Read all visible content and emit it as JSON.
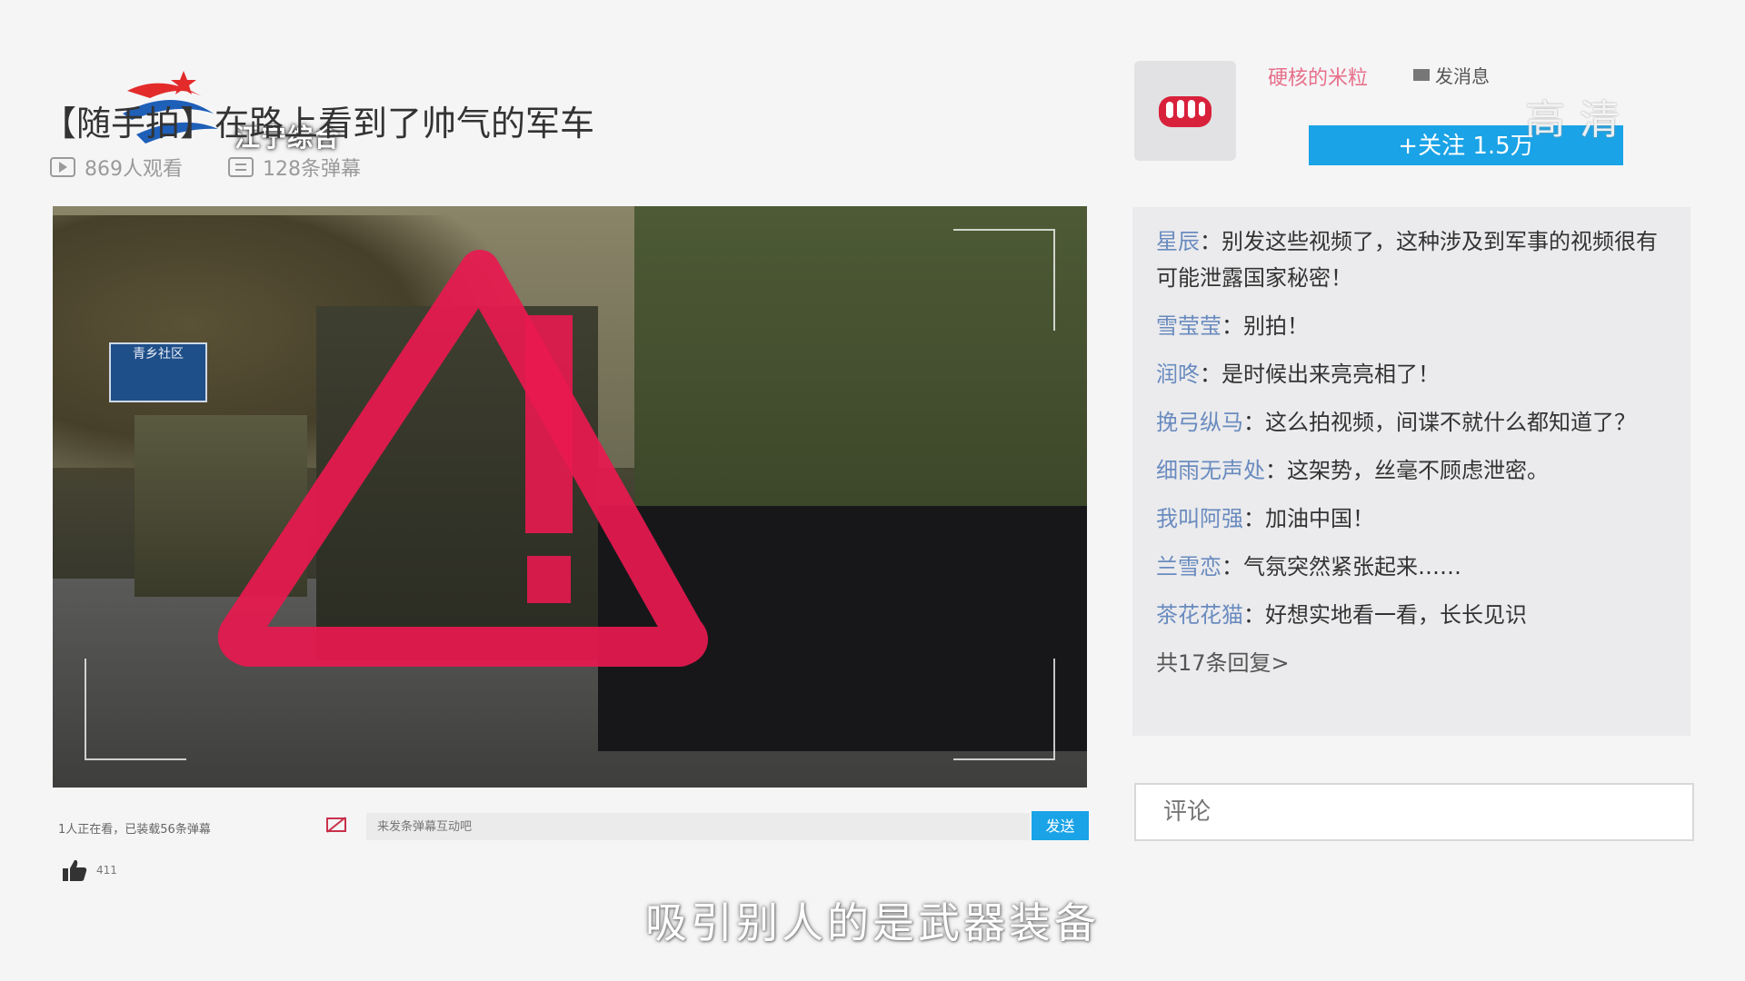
{
  "broadcast": {
    "station_logo_text": "江宁综合",
    "quality_badge": "高清",
    "subtitle": "吸引别人的是武器装备"
  },
  "video": {
    "title": "【随手拍】在路上看到了帅气的军车",
    "views": "869人观看",
    "danmaku_count": "128条弹幕",
    "road_sign": "青乡社区"
  },
  "danmaku_bar": {
    "status": "1人正在看，已装载56条弹幕",
    "input_placeholder": "来发条弹幕互动吧",
    "send_label": "发送",
    "like_count": "411"
  },
  "uploader": {
    "name": "硬核的米粒",
    "message_label": "发消息",
    "follow_label": "+关注  1.5万"
  },
  "comments": [
    {
      "user": "星辰",
      "text": "别发这些视频了，这种涉及到军事的视频很有可能泄露国家秘密！"
    },
    {
      "user": "雪莹莹",
      "text": "别拍！"
    },
    {
      "user": "润咚",
      "text": "是时候出来亮亮相了！"
    },
    {
      "user": "挽弓纵马",
      "text": "这么拍视频，间谍不就什么都知道了？"
    },
    {
      "user": "细雨无声处",
      "text": "这架势，丝毫不顾虑泄密。"
    },
    {
      "user": "我叫阿强",
      "text": "加油中国！"
    },
    {
      "user": "兰雪恋",
      "text": "气氛突然紧张起来……"
    },
    {
      "user": "茶花花猫",
      "text": "好想实地看一看，长长见识"
    }
  ],
  "comments_more": "共17条回复>",
  "comment_input_placeholder": "评论",
  "colors": {
    "accent_blue": "#1aa3e6",
    "username_pink": "#e7708a",
    "comment_user_blue": "#6a8bbf",
    "warning_red": "#e8194f"
  },
  "icons": [
    "play-icon",
    "danmaku-icon",
    "danmaku-toggle-icon",
    "thumbs-up-icon",
    "envelope-icon",
    "fist-icon",
    "warning-triangle-icon"
  ]
}
